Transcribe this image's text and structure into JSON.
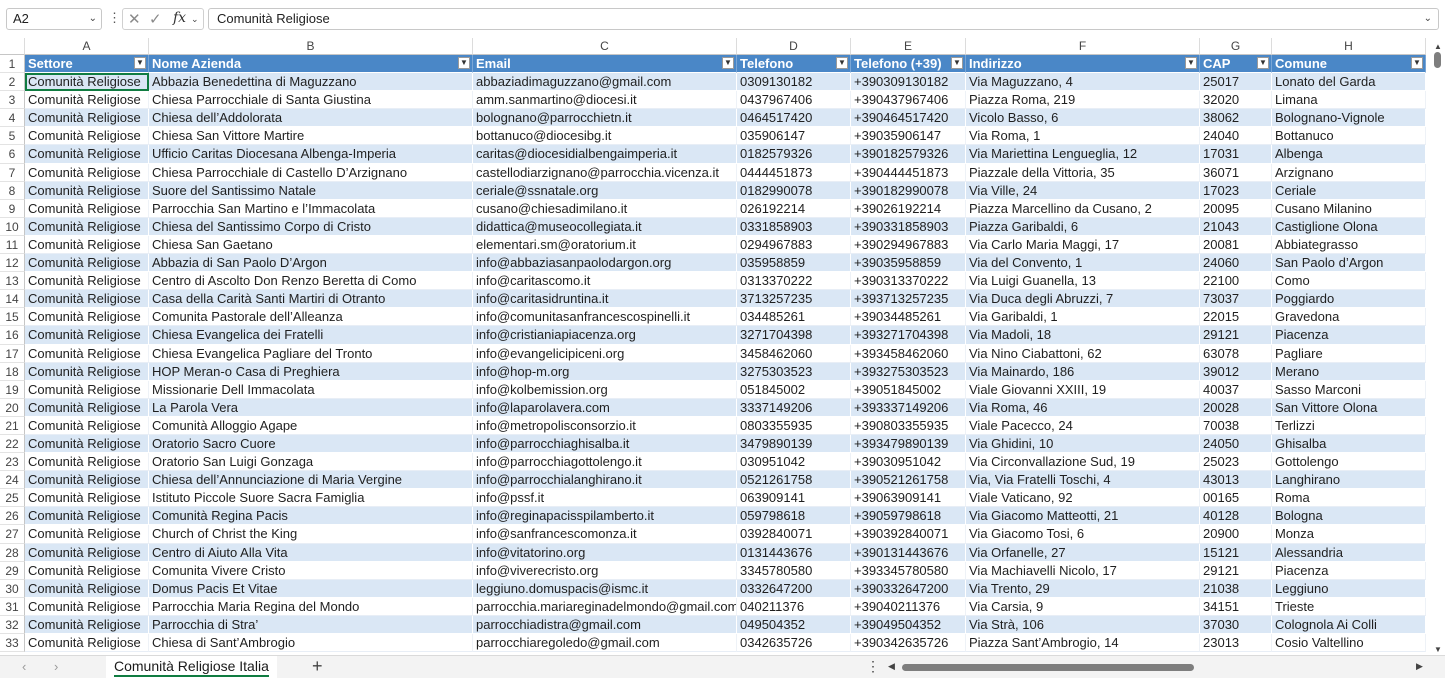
{
  "formula_bar": {
    "name_box": "A2",
    "cancel_icon": "✕",
    "confirm_icon": "✓",
    "fx_label": "fx",
    "content": "Comunità Religiose"
  },
  "columns": [
    "A",
    "B",
    "C",
    "D",
    "E",
    "F",
    "G",
    "H"
  ],
  "headers": [
    "Settore",
    "Nome Azienda",
    "Email",
    "Telefono",
    "Telefono (+39)",
    "Indirizzo",
    "CAP",
    "Comune"
  ],
  "rows": [
    [
      "Comunità Religiose",
      "Abbazia Benedettina di Maguzzano",
      "abbaziadimaguzzano@gmail.com",
      "0309130182",
      "+390309130182",
      "Via Maguzzano, 4",
      "25017",
      "Lonato del Garda"
    ],
    [
      "Comunità Religiose",
      "Chiesa Parrocchiale di Santa Giustina",
      "amm.sanmartino@diocesi.it",
      "0437967406",
      "+390437967406",
      "Piazza Roma, 219",
      "32020",
      "Limana"
    ],
    [
      "Comunità Religiose",
      "Chiesa dell’Addolorata",
      "bolognano@parrocchietn.it",
      "0464517420",
      "+390464517420",
      "Vicolo Basso, 6",
      "38062",
      "Bolognano-Vignole"
    ],
    [
      "Comunità Religiose",
      "Chiesa San Vittore Martire",
      "bottanuco@diocesibg.it",
      "035906147",
      "+39035906147",
      "Via Roma, 1",
      "24040",
      "Bottanuco"
    ],
    [
      "Comunità Religiose",
      "Ufficio Caritas Diocesana Albenga-Imperia",
      "caritas@diocesidialbengaimperia.it",
      "0182579326",
      "+390182579326",
      "Via Mariettina Lengueglia, 12",
      "17031",
      "Albenga"
    ],
    [
      "Comunità Religiose",
      "Chiesa Parrocchiale di Castello D’Arzignano",
      "castellodiarzignano@parrocchia.vicenza.it",
      "0444451873",
      "+390444451873",
      "Piazzale della Vittoria, 35",
      "36071",
      "Arzignano"
    ],
    [
      "Comunità Religiose",
      "Suore del Santissimo Natale",
      "ceriale@ssnatale.org",
      "0182990078",
      "+390182990078",
      "Via Ville, 24",
      "17023",
      "Ceriale"
    ],
    [
      "Comunità Religiose",
      "Parrocchia San Martino e l’Immacolata",
      "cusano@chiesadimilano.it",
      "026192214",
      "+39026192214",
      "Piazza Marcellino da Cusano, 2",
      "20095",
      "Cusano Milanino"
    ],
    [
      "Comunità Religiose",
      "Chiesa del Santissimo Corpo di Cristo",
      "didattica@museocollegiata.it",
      "0331858903",
      "+390331858903",
      "Piazza Garibaldi, 6",
      "21043",
      "Castiglione Olona"
    ],
    [
      "Comunità Religiose",
      "Chiesa San Gaetano",
      "elementari.sm@oratorium.it",
      "0294967883",
      "+390294967883",
      "Via Carlo Maria Maggi, 17",
      "20081",
      "Abbiategrasso"
    ],
    [
      "Comunità Religiose",
      "Abbazia di San Paolo D’Argon",
      "info@abbaziasanpaolodargon.org",
      "035958859",
      "+39035958859",
      "Via del Convento, 1",
      "24060",
      "San Paolo d’Argon"
    ],
    [
      "Comunità Religiose",
      "Centro di Ascolto Don Renzo Beretta di Como",
      "info@caritascomo.it",
      "0313370222",
      "+390313370222",
      "Via Luigi Guanella, 13",
      "22100",
      "Como"
    ],
    [
      "Comunità Religiose",
      "Casa della Carità Santi Martiri di Otranto",
      "info@caritasidruntina.it",
      "3713257235",
      "+393713257235",
      "Via Duca degli Abruzzi, 7",
      "73037",
      "Poggiardo"
    ],
    [
      "Comunità Religiose",
      "Comunita Pastorale dell’Alleanza",
      "info@comunitasanfrancescospinelli.it",
      "034485261",
      "+39034485261",
      "Via Garibaldi, 1",
      "22015",
      "Gravedona"
    ],
    [
      "Comunità Religiose",
      "Chiesa Evangelica dei Fratelli",
      "info@cristianiapiacenza.org",
      "3271704398",
      "+393271704398",
      "Via Madoli, 18",
      "29121",
      "Piacenza"
    ],
    [
      "Comunità Religiose",
      "Chiesa Evangelica Pagliare del Tronto",
      "info@evangelicipiceni.org",
      "3458462060",
      "+393458462060",
      "Via Nino Ciabattoni, 62",
      "63078",
      "Pagliare"
    ],
    [
      "Comunità Religiose",
      "HOP Meran-o Casa di Preghiera",
      "info@hop-m.org",
      "3275303523",
      "+393275303523",
      "Via Mainardo, 186",
      "39012",
      "Merano"
    ],
    [
      "Comunità Religiose",
      "Missionarie Dell Immacolata",
      "info@kolbemission.org",
      "051845002",
      "+39051845002",
      "Viale Giovanni XXIII, 19",
      "40037",
      "Sasso Marconi"
    ],
    [
      "Comunità Religiose",
      "La Parola Vera",
      "info@laparolavera.com",
      "3337149206",
      "+393337149206",
      "Via Roma, 46",
      "20028",
      "San Vittore Olona"
    ],
    [
      "Comunità Religiose",
      "Comunità Alloggio Agape",
      "info@metropolisconsorzio.it",
      "0803355935",
      "+390803355935",
      "Viale Pacecco, 24",
      "70038",
      "Terlizzi"
    ],
    [
      "Comunità Religiose",
      "Oratorio Sacro Cuore",
      "info@parrocchiaghisalba.it",
      "3479890139",
      "+393479890139",
      "Via Ghidini, 10",
      "24050",
      "Ghisalba"
    ],
    [
      "Comunità Religiose",
      "Oratorio San Luigi Gonzaga",
      "info@parrocchiagottolengo.it",
      "030951042",
      "+39030951042",
      "Via Circonvallazione Sud, 19",
      "25023",
      "Gottolengo"
    ],
    [
      "Comunità Religiose",
      "Chiesa dell’Annunciazione di Maria Vergine",
      "info@parrocchialanghirano.it",
      "0521261758",
      "+390521261758",
      "Via, Via Fratelli Toschi, 4",
      "43013",
      "Langhirano"
    ],
    [
      "Comunità Religiose",
      "Istituto Piccole Suore Sacra Famiglia",
      "info@pssf.it",
      "063909141",
      "+39063909141",
      "Viale Vaticano, 92",
      "00165",
      "Roma"
    ],
    [
      "Comunità Religiose",
      "Comunità Regina Pacis",
      "info@reginapacisspilamberto.it",
      "059798618",
      "+39059798618",
      "Via Giacomo Matteotti, 21",
      "40128",
      "Bologna"
    ],
    [
      "Comunità Religiose",
      "Church of Christ the King",
      "info@sanfrancescomonza.it",
      "0392840071",
      "+390392840071",
      "Via Giacomo Tosi, 6",
      "20900",
      "Monza"
    ],
    [
      "Comunità Religiose",
      "Centro di Aiuto Alla Vita",
      "info@vitatorino.org",
      "0131443676",
      "+390131443676",
      "Via Orfanelle, 27",
      "15121",
      "Alessandria"
    ],
    [
      "Comunità Religiose",
      "Comunita Vivere Cristo",
      "info@viverecristo.org",
      "3345780580",
      "+393345780580",
      "Via Machiavelli Nicolo, 17",
      "29121",
      "Piacenza"
    ],
    [
      "Comunità Religiose",
      "Domus Pacis Et Vitae",
      "leggiuno.domuspacis@ismc.it",
      "0332647200",
      "+390332647200",
      "Via Trento, 29",
      "21038",
      "Leggiuno"
    ],
    [
      "Comunità Religiose",
      "Parrocchia Maria Regina del Mondo",
      "parrocchia.mariareginadelmondo@gmail.com",
      "040211376",
      "+39040211376",
      "Via Carsia, 9",
      "34151",
      "Trieste"
    ],
    [
      "Comunità Religiose",
      "Parrocchia di Stra’",
      "parrocchiadistra@gmail.com",
      "049504352",
      "+39049504352",
      "Via Strà, 106",
      "37030",
      "Colognola Ai Colli"
    ],
    [
      "Comunità Religiose",
      "Chiesa di Sant’Ambrogio",
      "parrocchiaregoledo@gmail.com",
      "0342635726",
      "+390342635726",
      "Piazza Sant’Ambrogio, 14",
      "23013",
      "Cosio Valtellino"
    ]
  ],
  "sheet_tab": "Comunità Religiose Italia",
  "add_sheet": "+",
  "accent_color": "#107c41",
  "header_color": "#4a87c7",
  "band_color": "#dae7f5"
}
